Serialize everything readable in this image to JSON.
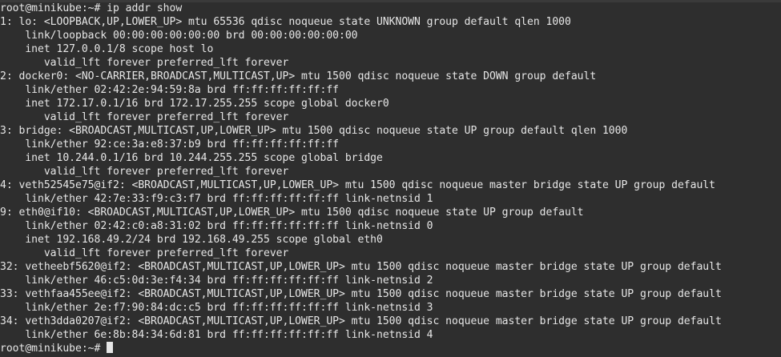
{
  "terminal": {
    "lines": [
      "root@minikube:~# ip addr show",
      "1: lo: <LOOPBACK,UP,LOWER_UP> mtu 65536 qdisc noqueue state UNKNOWN group default qlen 1000",
      "    link/loopback 00:00:00:00:00:00 brd 00:00:00:00:00:00",
      "    inet 127.0.0.1/8 scope host lo",
      "       valid_lft forever preferred_lft forever",
      "2: docker0: <NO-CARRIER,BROADCAST,MULTICAST,UP> mtu 1500 qdisc noqueue state DOWN group default",
      "    link/ether 02:42:2e:94:59:8a brd ff:ff:ff:ff:ff:ff",
      "    inet 172.17.0.1/16 brd 172.17.255.255 scope global docker0",
      "       valid_lft forever preferred_lft forever",
      "3: bridge: <BROADCAST,MULTICAST,UP,LOWER_UP> mtu 1500 qdisc noqueue state UP group default qlen 1000",
      "    link/ether 92:ce:3a:e8:37:b9 brd ff:ff:ff:ff:ff:ff",
      "    inet 10.244.0.1/16 brd 10.244.255.255 scope global bridge",
      "       valid_lft forever preferred_lft forever",
      "4: veth52545e75@if2: <BROADCAST,MULTICAST,UP,LOWER_UP> mtu 1500 qdisc noqueue master bridge state UP group default",
      "    link/ether 42:7e:33:f9:c3:f7 brd ff:ff:ff:ff:ff:ff link-netnsid 1",
      "9: eth0@if10: <BROADCAST,MULTICAST,UP,LOWER_UP> mtu 1500 qdisc noqueue state UP group default",
      "    link/ether 02:42:c0:a8:31:02 brd ff:ff:ff:ff:ff:ff link-netnsid 0",
      "    inet 192.168.49.2/24 brd 192.168.49.255 scope global eth0",
      "       valid_lft forever preferred_lft forever",
      "32: vetheebf5620@if2: <BROADCAST,MULTICAST,UP,LOWER_UP> mtu 1500 qdisc noqueue master bridge state UP group default",
      "    link/ether 46:c5:0d:3e:f4:34 brd ff:ff:ff:ff:ff:ff link-netnsid 2",
      "33: vethfaa455ee@if2: <BROADCAST,MULTICAST,UP,LOWER_UP> mtu 1500 qdisc noqueue master bridge state UP group default",
      "    link/ether 2e:f7:90:84:dc:c5 brd ff:ff:ff:ff:ff:ff link-netnsid 3",
      "34: veth3dda0207@if2: <BROADCAST,MULTICAST,UP,LOWER_UP> mtu 1500 qdisc noqueue master bridge state UP group default",
      "    link/ether 6e:8b:84:34:6d:81 brd ff:ff:ff:ff:ff:ff link-netnsid 4"
    ],
    "prompt": "root@minikube:~# "
  },
  "colors": {
    "background": "#2e2e2e",
    "foreground": "#e6e6e6"
  }
}
